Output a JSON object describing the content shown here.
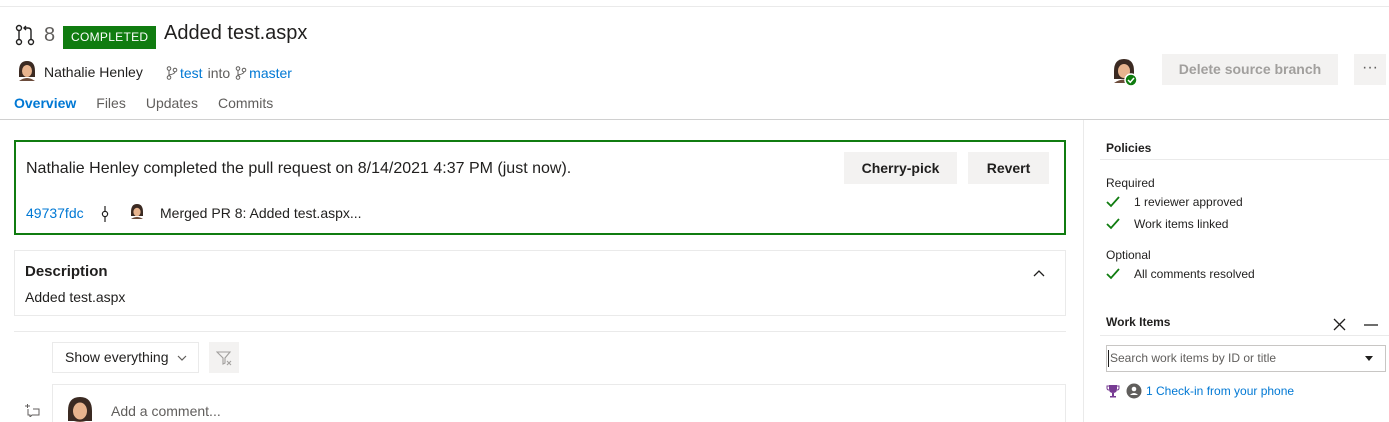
{
  "pr": {
    "id": "8",
    "status": "COMPLETED",
    "title": "Added test.aspx",
    "author": "Nathalie Henley",
    "source_branch": "test",
    "into_text": "into",
    "target_branch": "master"
  },
  "tabs": [
    {
      "label": "Overview",
      "active": true
    },
    {
      "label": "Files",
      "active": false
    },
    {
      "label": "Updates",
      "active": false
    },
    {
      "label": "Commits",
      "active": false
    }
  ],
  "header_actions": {
    "delete_branch_label": "Delete source branch",
    "more_label": "···"
  },
  "completed": {
    "message": "Nathalie Henley completed the pull request on 8/14/2021 4:37 PM (just now).",
    "cherry_pick_label": "Cherry-pick",
    "revert_label": "Revert",
    "commit_hash": "49737fdc",
    "commit_message": "Merged PR 8: Added test.aspx..."
  },
  "description": {
    "title": "Description",
    "text": "Added test.aspx"
  },
  "activity": {
    "filter_label": "Show everything",
    "comment_placeholder": "Add a comment..."
  },
  "policies": {
    "title": "Policies",
    "required_label": "Required",
    "required_items": [
      "1 reviewer approved",
      "Work items linked"
    ],
    "optional_label": "Optional",
    "optional_items": [
      "All comments resolved"
    ]
  },
  "work_items": {
    "title": "Work Items",
    "search_placeholder": "Search work items by ID or title",
    "checkin_link": "1 Check-in from your phone"
  },
  "colors": {
    "accent": "#0078d4",
    "success": "#107c10"
  }
}
